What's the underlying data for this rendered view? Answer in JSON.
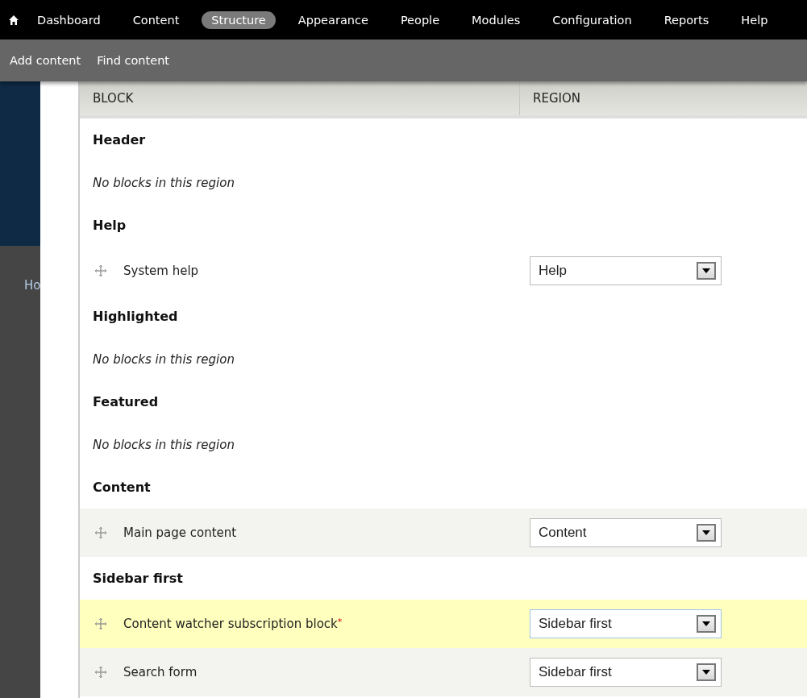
{
  "toolbar": {
    "items": [
      {
        "label": "Dashboard",
        "selected": false
      },
      {
        "label": "Content",
        "selected": false
      },
      {
        "label": "Structure",
        "selected": true
      },
      {
        "label": "Appearance",
        "selected": false
      },
      {
        "label": "People",
        "selected": false
      },
      {
        "label": "Modules",
        "selected": false
      },
      {
        "label": "Configuration",
        "selected": false
      },
      {
        "label": "Reports",
        "selected": false
      },
      {
        "label": "Help",
        "selected": false
      }
    ]
  },
  "shortcuts": [
    "Add content",
    "Find content"
  ],
  "breadcrumb": "Ho",
  "table": {
    "columns": [
      "BLOCK",
      "REGION"
    ],
    "rows": [
      {
        "kind": "region",
        "title": "Header"
      },
      {
        "kind": "message",
        "text": "No blocks in this region"
      },
      {
        "kind": "region",
        "title": "Help"
      },
      {
        "kind": "block",
        "name": "System help",
        "region": "Help",
        "even": false,
        "changed": false,
        "focused": false
      },
      {
        "kind": "region",
        "title": "Highlighted"
      },
      {
        "kind": "message",
        "text": "No blocks in this region"
      },
      {
        "kind": "region",
        "title": "Featured"
      },
      {
        "kind": "message",
        "text": "No blocks in this region"
      },
      {
        "kind": "region",
        "title": "Content"
      },
      {
        "kind": "block",
        "name": "Main page content",
        "region": "Content",
        "even": true,
        "changed": false,
        "focused": false
      },
      {
        "kind": "region",
        "title": "Sidebar first"
      },
      {
        "kind": "block",
        "name": "Content watcher subscription block",
        "marker": "*",
        "region": "Sidebar first",
        "changed": true,
        "focused": true
      },
      {
        "kind": "block",
        "name": "Search form",
        "region": "Sidebar first",
        "even": true,
        "changed": false,
        "focused": false
      }
    ]
  }
}
